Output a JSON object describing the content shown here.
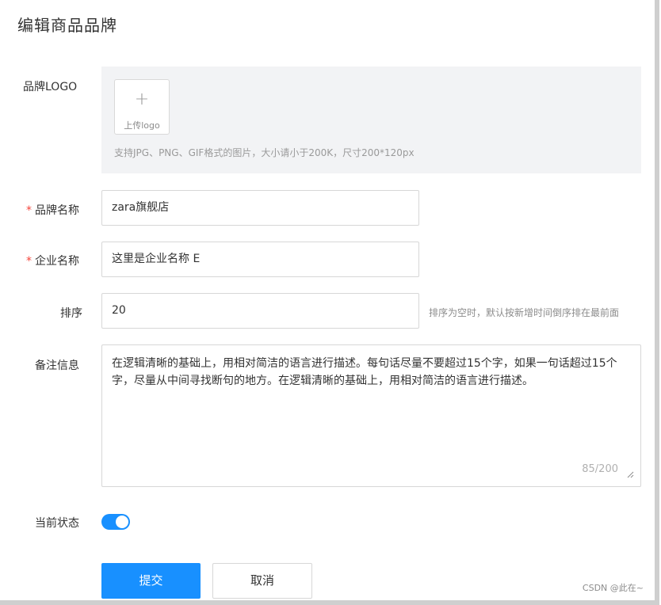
{
  "page": {
    "title": "编辑商品品牌"
  },
  "logo": {
    "label": "品牌LOGO",
    "upload_icon": "plus-icon",
    "upload_symbol": "+",
    "upload_text": "上传logo",
    "hint": "支持JPG、PNG、GIF格式的图片，大小请小于200K，尺寸200*120px"
  },
  "brand_name": {
    "required_mark": "*",
    "label": "品牌名称",
    "value": "zara旗舰店"
  },
  "company_name": {
    "required_mark": "*",
    "label": "企业名称",
    "value": "这里是企业名称 E"
  },
  "sort": {
    "label": "排序",
    "value": "20",
    "hint": "排序为空时，默认按新增时间倒序排在最前面"
  },
  "remark": {
    "label": "备注信息",
    "value": "在逻辑清晰的基础上，用相对简洁的语言进行描述。每句话尽量不要超过15个字，如果一句话超过15个字，尽量从中间寻找断句的地方。在逻辑清晰的基础上，用相对简洁的语言进行描述。",
    "count": "85/200"
  },
  "status": {
    "label": "当前状态",
    "enabled": true
  },
  "actions": {
    "submit_label": "提交",
    "cancel_label": "取消"
  },
  "watermark": "CSDN @此在~",
  "colors": {
    "primary": "#1890ff",
    "required": "#f5453b",
    "panel_bg": "#f2f3f5"
  }
}
